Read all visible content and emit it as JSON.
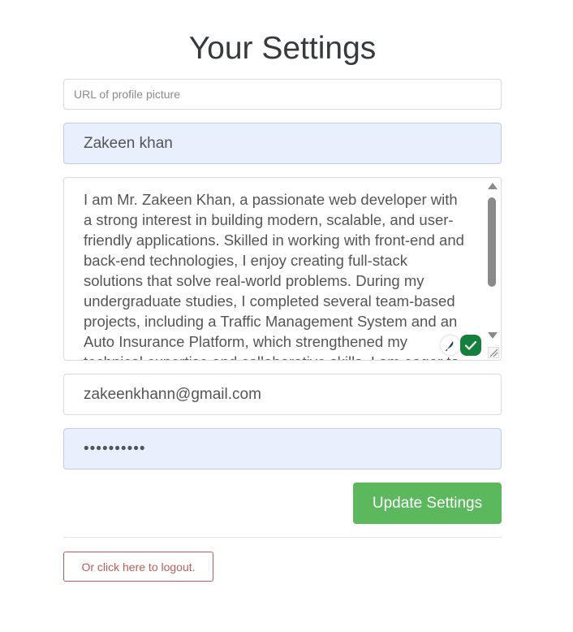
{
  "page": {
    "title": "Your Settings"
  },
  "form": {
    "image_placeholder": "URL of profile picture",
    "image_value": "",
    "username": "Zakeen khan",
    "bio": "I am Mr. Zakeen Khan, a passionate web developer with a strong interest in building modern, scalable, and user-friendly applications. Skilled in working with front-end and back-end technologies, I enjoy creating full-stack solutions that solve real-world problems. During my undergraduate studies, I completed several team-based projects, including a Traffic Management System and an Auto Insurance Platform, which strengthened my technical expertise and collaborative skills. I am eager to",
    "email": "zakeenkhann@gmail.com",
    "password": "••••••••••",
    "submit_label": "Update Settings"
  },
  "logout_label": "Or click here to logout.",
  "icons": {
    "grammar_feather": "feather-icon",
    "grammar_check": "check-icon",
    "resize": "resize-handle-icon"
  },
  "colors": {
    "primary_button": "#5cb85c",
    "danger_outline": "#b85c5c",
    "autofill_bg": "#e8f0fe"
  }
}
